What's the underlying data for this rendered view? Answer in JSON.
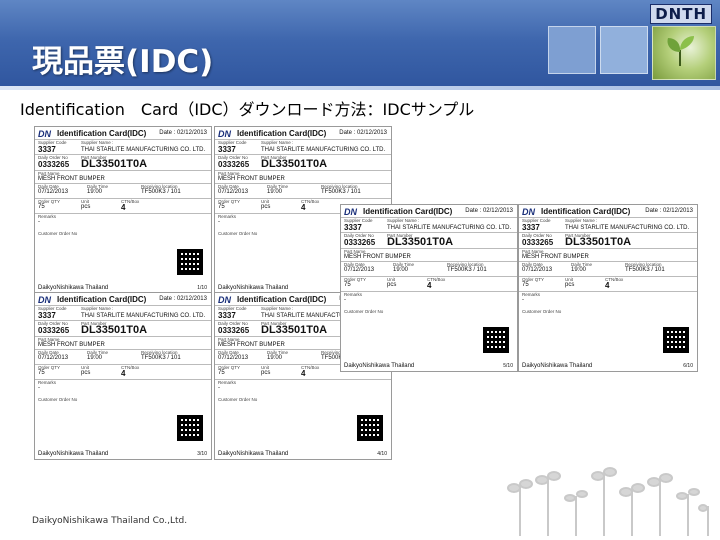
{
  "header": {
    "brand": "DNTH",
    "title": "現品票(IDC)"
  },
  "subtitle": "Identification　Card（IDC）ダウンロード方法：IDCサンプル",
  "card": {
    "logo": "DN",
    "title": "Identification Card(IDC)",
    "date": "Date : 02/12/2013",
    "supplier_code_label": "Supplier Code",
    "supplier_code": "3337",
    "supplier_name_label": "Supplier Name :",
    "supplier_name": "THAI STARLITE MANUFACTURING CO. LTD.",
    "order_no_label": "Daily Order No",
    "order_no": "0333265",
    "part_no_label": "Part Number",
    "part_no": "DL33501T0A",
    "part_name_label": "Part Name",
    "part_name": "MESH FRONT BUMPER",
    "daily_date_label": "Daily Date",
    "daily_date": "07/12/2013",
    "daily_time_label": "Daily Time",
    "daily_time": "19:00",
    "location_label": "Receiving location",
    "location": "TF500K3 / 101",
    "qty_label": "Order QTY",
    "qty": "75",
    "unit_label": "Unit",
    "unit": "pcs",
    "ctn_label": "CTN/Box",
    "ctn": "4",
    "remarks_label": "Remarks",
    "remarks": "-",
    "customer_order_label": "Customer Order No",
    "footer": "DaikyoNishikawa Thailand"
  },
  "cards": [
    {
      "page": "1/10"
    },
    {
      "page": "2/10"
    },
    {
      "page": "3/10"
    },
    {
      "page": "4/10"
    },
    {
      "page": "5/10"
    },
    {
      "page": "6/10"
    }
  ],
  "footer_text": "DaikyoNishikawa Thailand Co.,Ltd."
}
